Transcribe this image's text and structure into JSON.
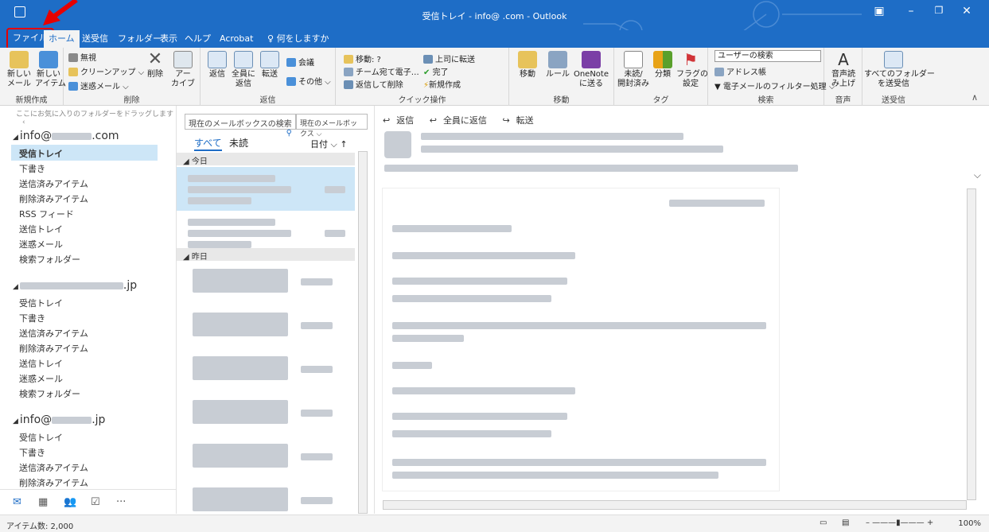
{
  "window": {
    "title": "受信トレイ - info@ .com - Outlook"
  },
  "tabs": [
    "ファイル",
    "ホーム",
    "送受信",
    "フォルダー",
    "表示",
    "ヘルプ",
    "Acrobat",
    "何をしますか"
  ],
  "ribbon": {
    "new_group": {
      "label": "新規作成",
      "new_mail": "新しい\nメール",
      "new_item": "新しい\nアイテム"
    },
    "delete_group": {
      "label": "削除",
      "ignore": "無視",
      "cleanup": "クリーンアップ",
      "junk": "迷惑メール",
      "delete": "削除",
      "archive": "アー\nカイブ"
    },
    "respond_group": {
      "label": "返信",
      "reply": "返信",
      "reply_all": "全員に\n返信",
      "forward": "転送",
      "meeting": "会議",
      "more": "その他"
    },
    "quick_steps": {
      "label": "クイック操作",
      "move": "移動: ?",
      "team": "チーム宛て電子…",
      "reply_delete": "返信して削除",
      "to_manager": "上司に転送",
      "done": "完了",
      "create_new": "新規作成"
    },
    "move_group": {
      "label": "移動",
      "move": "移動",
      "rules": "ルール",
      "onenote": "OneNote\nに送る"
    },
    "tags_group": {
      "label": "タグ",
      "unread": "未読/\n開封済み",
      "categorize": "分類",
      "flag": "フラグの\n設定"
    },
    "find_group": {
      "label": "検索",
      "search_users": "ユーザーの検索",
      "address_book": "アドレス帳",
      "filter": "電子メールのフィルター処理"
    },
    "speech_group": {
      "label": "音声",
      "read_aloud": "音声読\nみ上げ"
    },
    "sendrecv_group": {
      "label": "送受信",
      "all_folders": "すべてのフォルダー\nを送受信"
    }
  },
  "nav": {
    "favorites_hint": "ここにお気に入りのフォルダーをドラッグします",
    "accounts": [
      {
        "name_prefix": "info@",
        "name_suffix": ".com",
        "folders": [
          "受信トレイ",
          "下書き",
          "送信済みアイテム",
          "削除済みアイテム",
          "RSS フィード",
          "送信トレイ",
          "迷惑メール",
          "検索フォルダー"
        ]
      },
      {
        "name_prefix": "",
        "name_suffix": ".jp",
        "folders": [
          "受信トレイ",
          "下書き",
          "送信済みアイテム",
          "削除済みアイテム",
          "送信トレイ",
          "迷惑メール",
          "検索フォルダー"
        ]
      },
      {
        "name_prefix": "info@",
        "name_suffix": ".jp",
        "folders": [
          "受信トレイ",
          "下書き",
          "送信済みアイテム",
          "削除済みアイテム"
        ]
      }
    ]
  },
  "list": {
    "search_placeholder": "現在のメールボックスの検索",
    "scope": "現在のメールボックス",
    "filter_all": "すべて",
    "filter_unread": "未読",
    "sort": "日付",
    "sections": [
      "今日",
      "昨日"
    ]
  },
  "reading": {
    "reply": "返信",
    "reply_all": "全員に返信",
    "forward": "転送"
  },
  "status": {
    "item_count": "アイテム数: 2,000",
    "zoom": "100%"
  },
  "colors": {
    "accent": "#1e6dc6",
    "selection": "#cde6f7",
    "annotation": "#e60000"
  }
}
